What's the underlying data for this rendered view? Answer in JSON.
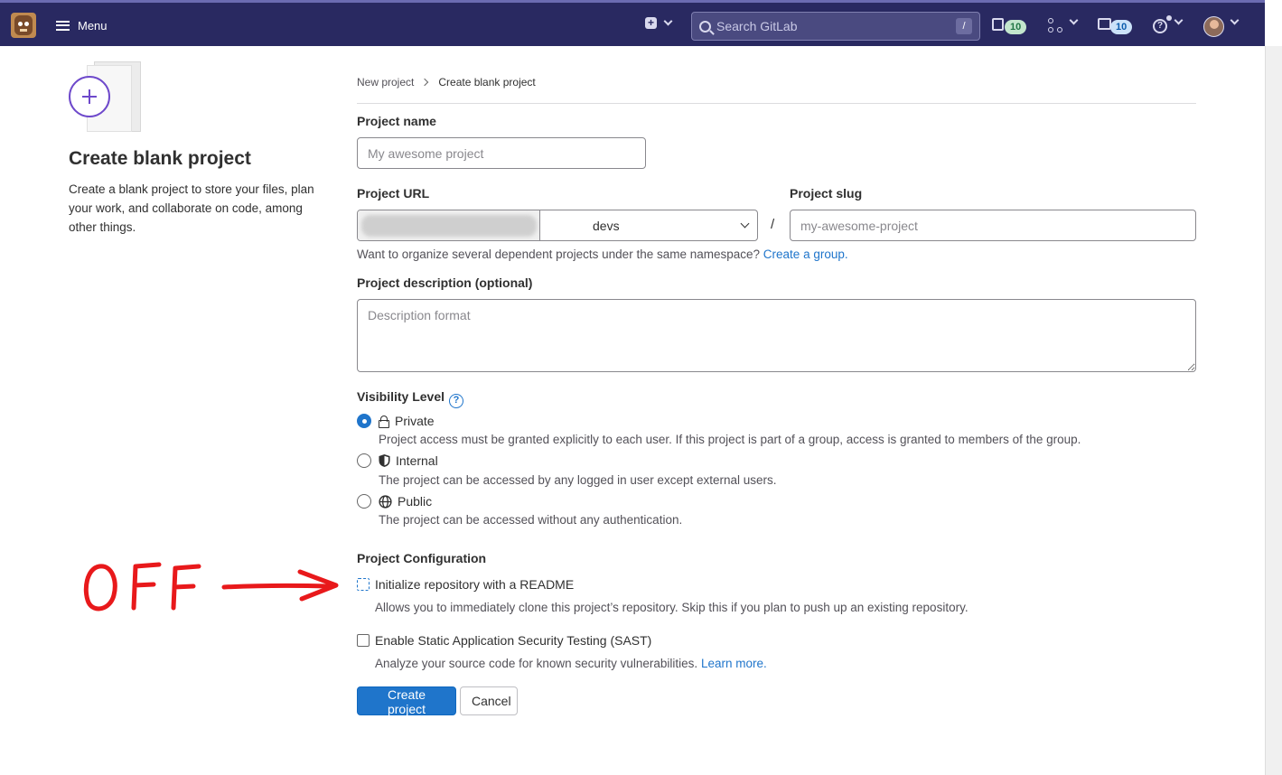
{
  "navbar": {
    "menu_label": "Menu",
    "search_placeholder": "Search GitLab",
    "search_shortcut": "/",
    "issues_count": "10",
    "todos_count": "10"
  },
  "sidebar": {
    "title": "Create blank project",
    "description": "Create a blank project to store your files, plan your work, and collaborate on code, among other things."
  },
  "breadcrumb": {
    "parent": "New project",
    "current": "Create blank project"
  },
  "form": {
    "project_name_label": "Project name",
    "project_name_placeholder": "My awesome project",
    "project_url_label": "Project URL",
    "namespace_value": "devs",
    "url_separator": "/",
    "project_slug_label": "Project slug",
    "project_slug_placeholder": "my-awesome-project",
    "group_hint": "Want to organize several dependent projects under the same namespace?",
    "group_link": "Create a group.",
    "description_label": "Project description (optional)",
    "description_placeholder": "Description format"
  },
  "visibility": {
    "label": "Visibility Level",
    "help_glyph": "?",
    "options": [
      {
        "label": "Private",
        "icon": "lock-icon",
        "description": "Project access must be granted explicitly to each user. If this project is part of a group, access is granted to members of the group.",
        "selected": true
      },
      {
        "label": "Internal",
        "icon": "shield-icon",
        "description": "The project can be accessed by any logged in user except external users.",
        "selected": false
      },
      {
        "label": "Public",
        "icon": "globe-icon",
        "description": "The project can be accessed without any authentication.",
        "selected": false
      }
    ]
  },
  "configuration": {
    "label": "Project Configuration",
    "readme_label": "Initialize repository with a README",
    "readme_checked": false,
    "readme_description": "Allows you to immediately clone this project’s repository. Skip this if you plan to push up an existing repository.",
    "sast_label": "Enable Static Application Security Testing (SAST)",
    "sast_checked": false,
    "sast_description": "Analyze your source code for known security vulnerabilities.",
    "sast_link": "Learn more."
  },
  "actions": {
    "create_label": "Create project",
    "cancel_label": "Cancel"
  },
  "annotation": {
    "text": "OFF",
    "color": "#e8191b"
  },
  "colors": {
    "navbar": "#292961",
    "primary": "#1f75cb",
    "illustration_accent": "#6e49cb"
  }
}
